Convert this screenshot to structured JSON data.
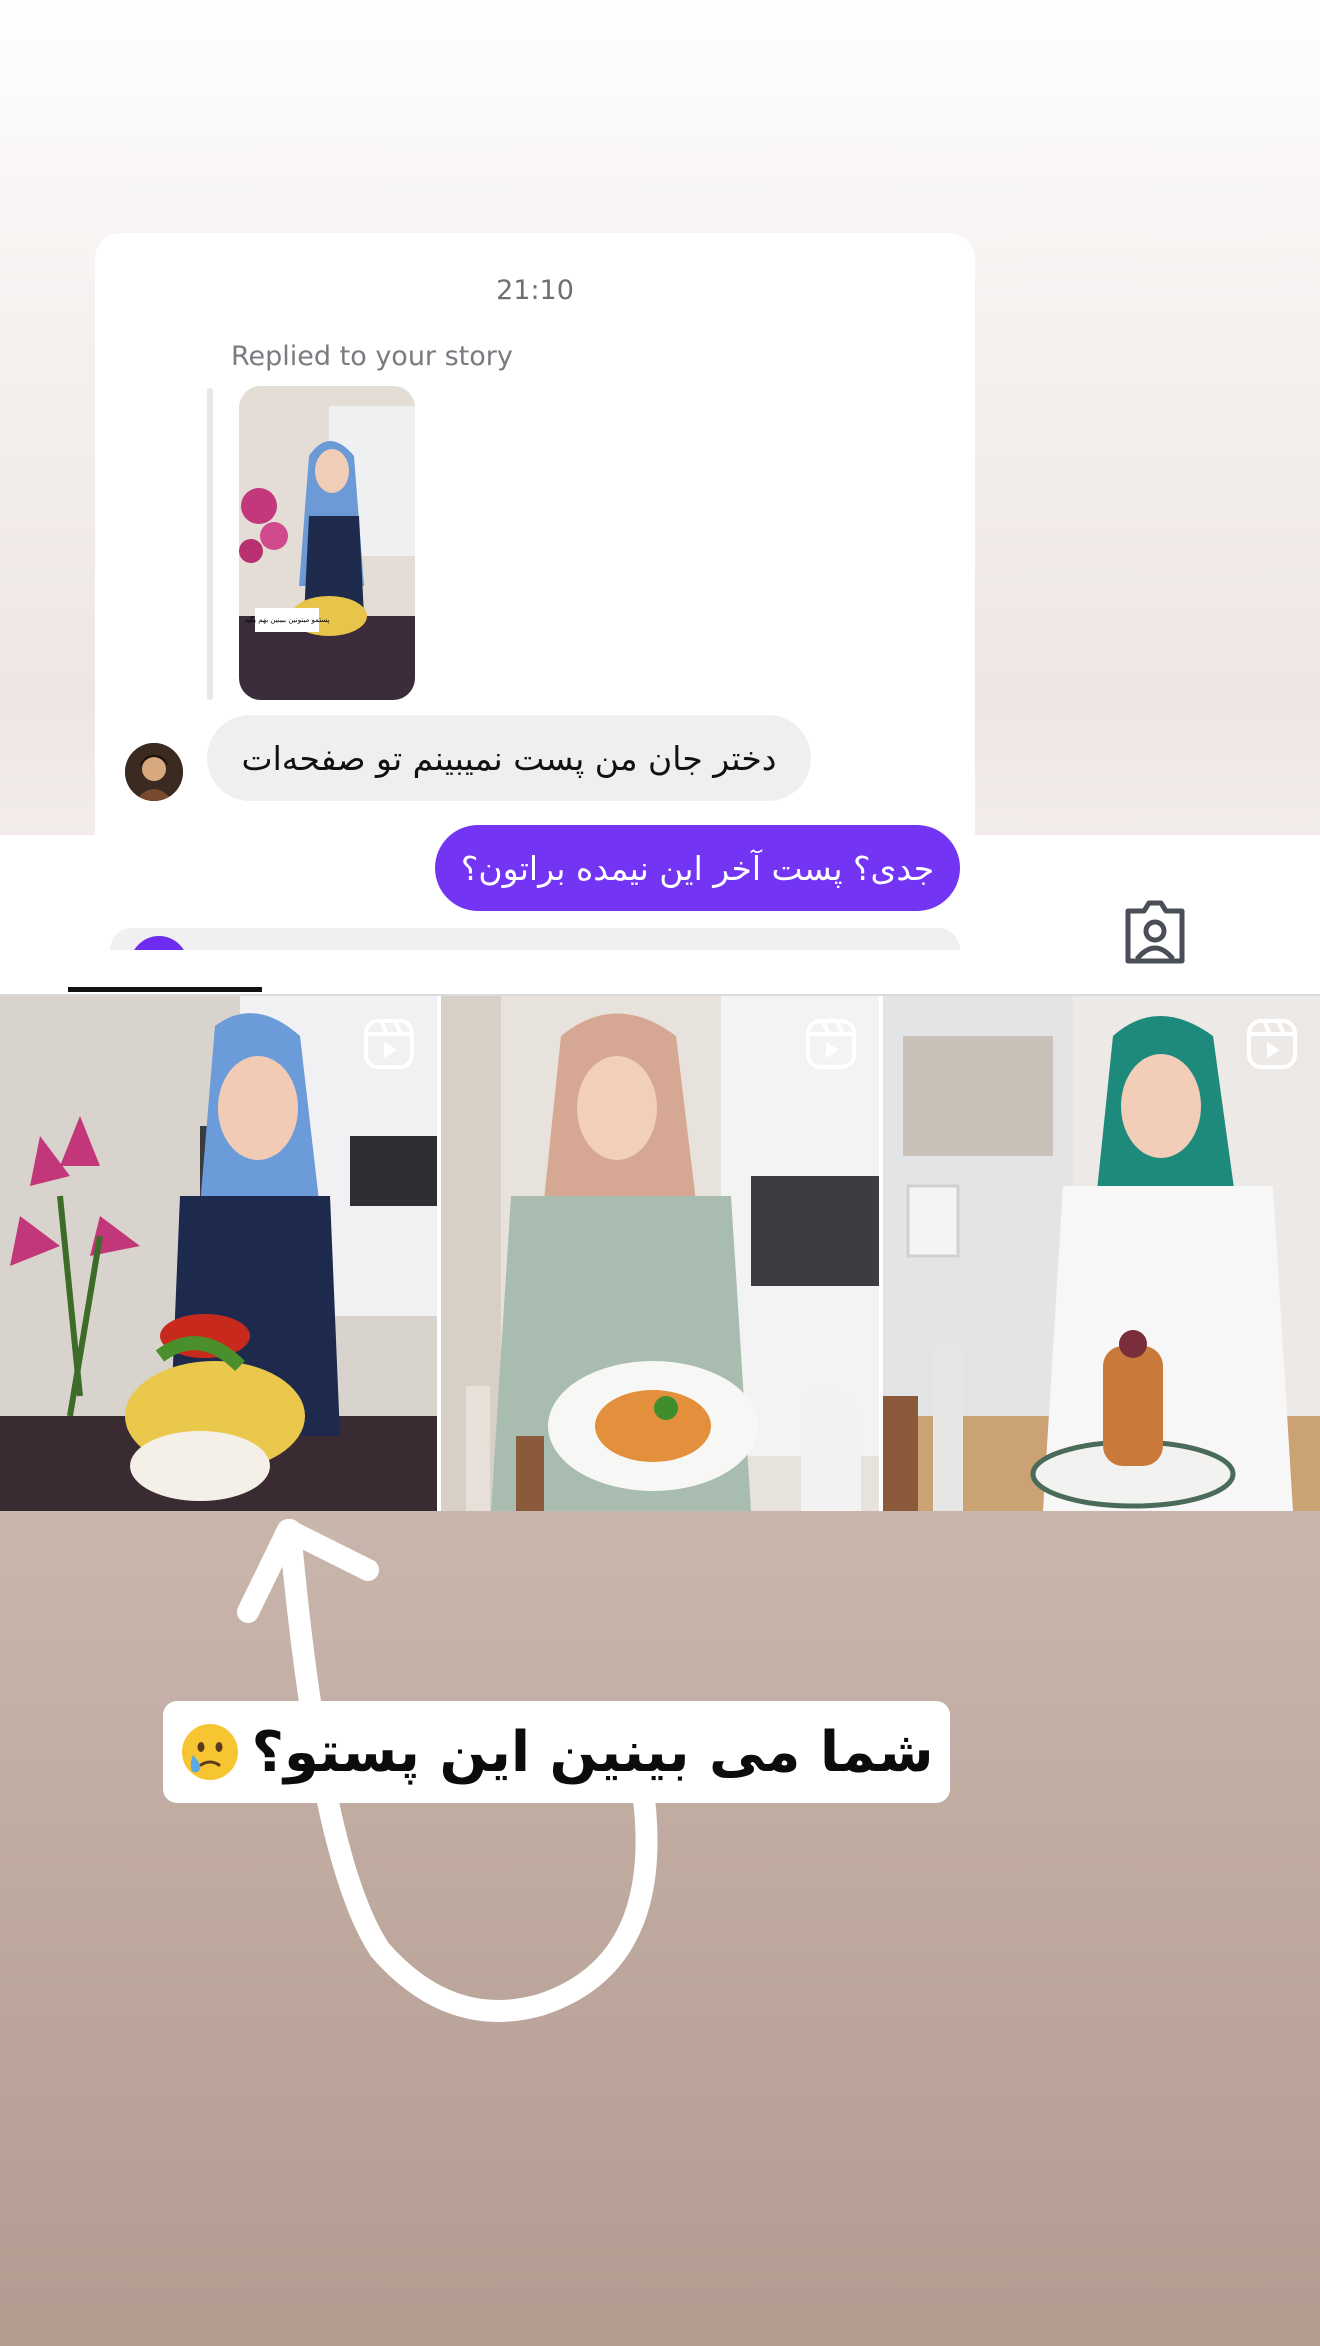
{
  "chat": {
    "time": "21:10",
    "reply_label": "Replied to your story",
    "story_sticker_text": "پستمو میتونین ببینین\nبهم بگید",
    "incoming_message": "دختر جان من پست نمیبینم تو صفحه‌ات",
    "outgoing_message": "جدی؟ پست آخر این نیمده براتون؟"
  },
  "profile_grid": {
    "items": [
      {
        "type": "reel",
        "icon": "reels-icon"
      },
      {
        "type": "reel",
        "icon": "reels-icon"
      },
      {
        "type": "reel",
        "icon": "reels-icon"
      }
    ]
  },
  "caption": {
    "text": "شما می بینین این پستو؟",
    "emoji": "crying-face"
  },
  "colors": {
    "accent_purple": "#7434f3",
    "bubble_gray": "#efefef"
  }
}
